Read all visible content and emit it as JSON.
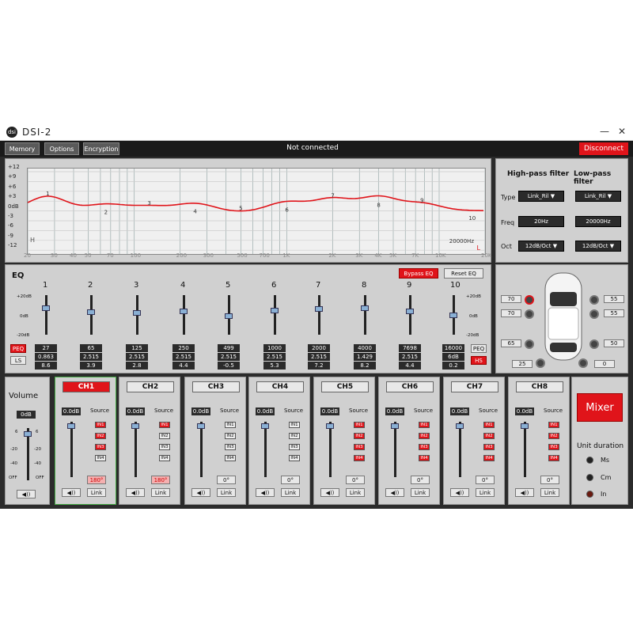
{
  "app": {
    "title": "DSI-2",
    "logo_text": "dsi"
  },
  "window_controls": {
    "minimize": "—",
    "close": "✕"
  },
  "menu": {
    "memory": "Memory",
    "options": "Options",
    "encryption": "Encryption",
    "status": "Not connected",
    "disconnect": "Disconnect"
  },
  "graph": {
    "y_ticks": [
      "+12",
      "+9",
      "+6",
      "+3",
      "0dB",
      "-3",
      "-6",
      "-9",
      "-12"
    ],
    "x_ticks": [
      "20",
      "30",
      "40",
      "50",
      "70",
      "100",
      "200",
      "300",
      "500",
      "700",
      "1K",
      "2K",
      "3K",
      "4K",
      "5K",
      "7K",
      "10K",
      "20K"
    ],
    "h_marker": "H",
    "l_marker": "L",
    "freq_readout": "20000Hz",
    "points": [
      "1",
      "2",
      "3",
      "4",
      "5",
      "6",
      "7",
      "8",
      "9",
      "10"
    ],
    "curve_color": "#e0141a"
  },
  "filters": {
    "hp_title": "High-pass filter",
    "lp_title": "Low-pass filter",
    "type_label": "Type",
    "freq_label": "Freq",
    "oct_label": "Oct",
    "hp_type": "Link_Ril",
    "lp_type": "Link_Ril",
    "hp_freq": "20Hz",
    "lp_freq": "20000Hz",
    "hp_oct": "12dB/Oct",
    "lp_oct": "12dB/Oct"
  },
  "eq": {
    "title": "EQ",
    "bypass": "Bypass EQ",
    "reset": "Reset EQ",
    "scale_top": "+20dB",
    "scale_mid": "0dB",
    "scale_bot": "-20dB",
    "peq": "PEQ",
    "ls": "LS",
    "hs": "HS",
    "bands": [
      {
        "n": "1",
        "f": "27",
        "q": "0.863",
        "g": "8.6"
      },
      {
        "n": "2",
        "f": "65",
        "q": "2.515",
        "g": "3.9"
      },
      {
        "n": "3",
        "f": "125",
        "q": "2.515",
        "g": "2.8"
      },
      {
        "n": "4",
        "f": "250",
        "q": "2.515",
        "g": "4.4"
      },
      {
        "n": "5",
        "f": "499",
        "q": "2.515",
        "g": "-0.5"
      },
      {
        "n": "6",
        "f": "1000",
        "q": "2.515",
        "g": "5.3"
      },
      {
        "n": "7",
        "f": "2000",
        "q": "2.515",
        "g": "7.2"
      },
      {
        "n": "8",
        "f": "4000",
        "q": "1.429",
        "g": "8.2"
      },
      {
        "n": "9",
        "f": "7698",
        "q": "2.515",
        "g": "4.4"
      },
      {
        "n": "10",
        "f": "16000",
        "q": "6dB",
        "g": "0.2"
      }
    ]
  },
  "car": {
    "fl": "70",
    "fl2": "70",
    "rl": "65",
    "sub": "25",
    "fr": "55",
    "fr2": "55",
    "rr": "50",
    "sub2": "0"
  },
  "volume": {
    "title": "Volume",
    "value": "0dB",
    "top": "6",
    "m20": "-20",
    "m40": "-40",
    "off": "OFF"
  },
  "channels": [
    {
      "name": "CH1",
      "gain": "0.0dB",
      "phase": "180°",
      "ins": [
        true,
        true,
        true,
        false
      ]
    },
    {
      "name": "CH2",
      "gain": "0.0dB",
      "phase": "180°",
      "ins": [
        true,
        false,
        false,
        false
      ]
    },
    {
      "name": "CH3",
      "gain": "0.0dB",
      "phase": "0°",
      "ins": [
        false,
        false,
        false,
        false
      ]
    },
    {
      "name": "CH4",
      "gain": "0.0dB",
      "phase": "0°",
      "ins": [
        false,
        false,
        false,
        false
      ]
    },
    {
      "name": "CH5",
      "gain": "0.0dB",
      "phase": "0°",
      "ins": [
        true,
        true,
        true,
        true
      ]
    },
    {
      "name": "CH6",
      "gain": "0.0dB",
      "phase": "0°",
      "ins": [
        true,
        true,
        true,
        true
      ]
    },
    {
      "name": "CH7",
      "gain": "0.0dB",
      "phase": "0°",
      "ins": [
        true,
        true,
        true,
        true
      ]
    },
    {
      "name": "CH8",
      "gain": "0.0dB",
      "phase": "0°",
      "ins": [
        true,
        true,
        true,
        true
      ]
    }
  ],
  "channel_labels": {
    "source": "Source",
    "link": "Link",
    "in1": "IN1",
    "in2": "IN2",
    "in3": "IN3",
    "in4": "IN4",
    "mute": "◀))"
  },
  "mixer": {
    "label": "Mixer",
    "unit_title": "Unit duration",
    "ms": "Ms",
    "cm": "Cm",
    "in": "In"
  }
}
